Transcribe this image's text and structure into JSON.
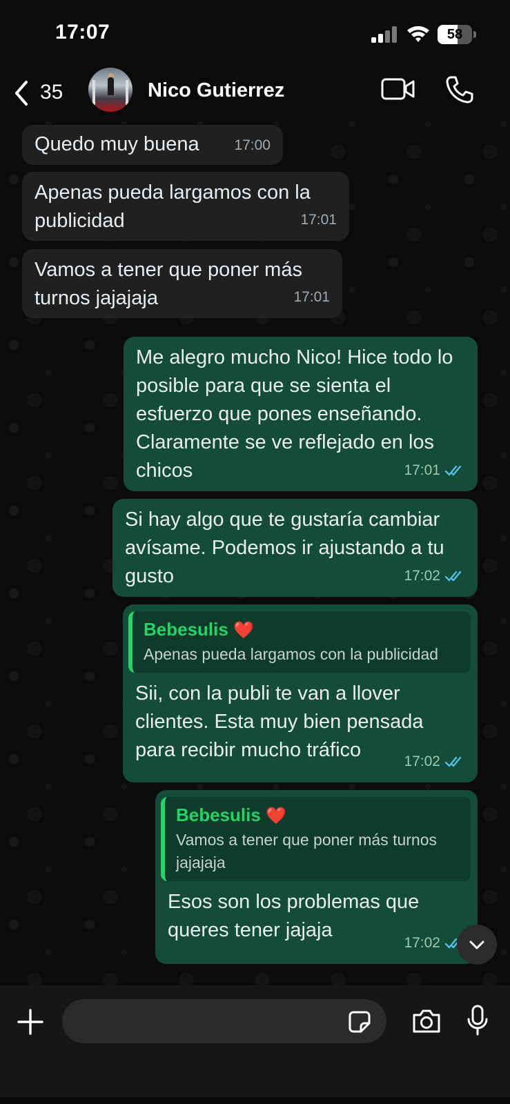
{
  "status_bar": {
    "time": "17:07",
    "battery_level": "58",
    "icons": [
      "signal-icon",
      "wifi-icon",
      "battery-icon"
    ]
  },
  "header": {
    "back_count": "35",
    "contact_name": "Nico Gutierrez",
    "icons": [
      "back-icon",
      "avatar",
      "video-call-icon",
      "voice-call-icon"
    ]
  },
  "messages": [
    {
      "direction": "incoming",
      "text": "Quedo muy buena",
      "time": "17:00"
    },
    {
      "direction": "incoming",
      "text": "Apenas pueda largamos con la publicidad",
      "time": "17:01"
    },
    {
      "direction": "incoming",
      "text": "Vamos a tener que poner más turnos jajajaja",
      "time": "17:01"
    },
    {
      "direction": "outgoing",
      "text": "Me alegro mucho Nico! Hice todo lo posible para que se sienta el esfuerzo que pones enseñando. Claramente se ve reflejado en los chicos",
      "time": "17:01",
      "status": "read"
    },
    {
      "direction": "outgoing",
      "text": "Si hay algo que te gustaría cambiar avísame. Podemos ir ajustando a tu gusto",
      "time": "17:02",
      "status": "read"
    },
    {
      "direction": "outgoing",
      "quote_author": "Bebesulis",
      "quote_emoji": "❤️",
      "quote_text": "Apenas pueda largamos con la publicidad",
      "text": "Sii, con la publi te van a llover clientes. Esta muy bien pensada para recibir mucho tráfico",
      "time": "17:02",
      "status": "read"
    },
    {
      "direction": "outgoing",
      "quote_author": "Bebesulis",
      "quote_emoji": "❤️",
      "quote_text": "Vamos a tener que poner más turnos jajajaja",
      "text": "Esos son los problemas que queres tener jajaja",
      "time": "17:02",
      "status": "read"
    }
  ],
  "input_bar": {
    "placeholder": "",
    "icons": [
      "plus-icon",
      "sticker-icon",
      "camera-icon",
      "microphone-icon"
    ]
  },
  "colors": {
    "incoming_bubble": "#1f2022",
    "outgoing_bubble": "#134d37",
    "quote_accent": "#25d366",
    "read_ticks": "#53bdeb"
  }
}
